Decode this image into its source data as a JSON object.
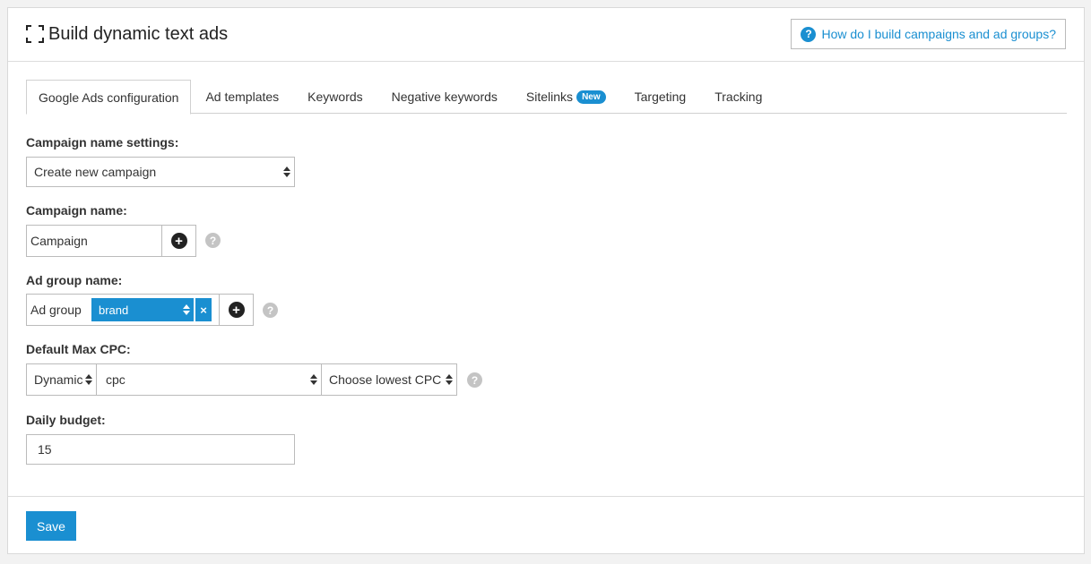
{
  "header": {
    "title": "Build dynamic text ads",
    "help_icon": "question-circle-icon",
    "help_label": "How do I build campaigns and ad groups?"
  },
  "tabs": [
    {
      "label": "Google Ads configuration",
      "active": true
    },
    {
      "label": "Ad templates"
    },
    {
      "label": "Keywords"
    },
    {
      "label": "Negative keywords"
    },
    {
      "label": "Sitelinks",
      "badge": "New"
    },
    {
      "label": "Targeting"
    },
    {
      "label": "Tracking"
    }
  ],
  "campaign_settings": {
    "label": "Campaign name settings:",
    "selected": "Create new campaign"
  },
  "campaign_name": {
    "label": "Campaign name:",
    "value": "Campaign"
  },
  "ad_group_name": {
    "label": "Ad group name:",
    "prefix": "Ad group",
    "tag": "brand",
    "remove": "×"
  },
  "max_cpc": {
    "label": "Default Max CPC:",
    "mode": "Dynamic",
    "field": "cpc",
    "strategy": "Choose lowest CPC"
  },
  "daily_budget": {
    "label": "Daily budget:",
    "value": "15"
  },
  "footer": {
    "save_label": "Save"
  },
  "colors": {
    "accent": "#1a8fd1",
    "help_grey": "#c4c4c4"
  }
}
